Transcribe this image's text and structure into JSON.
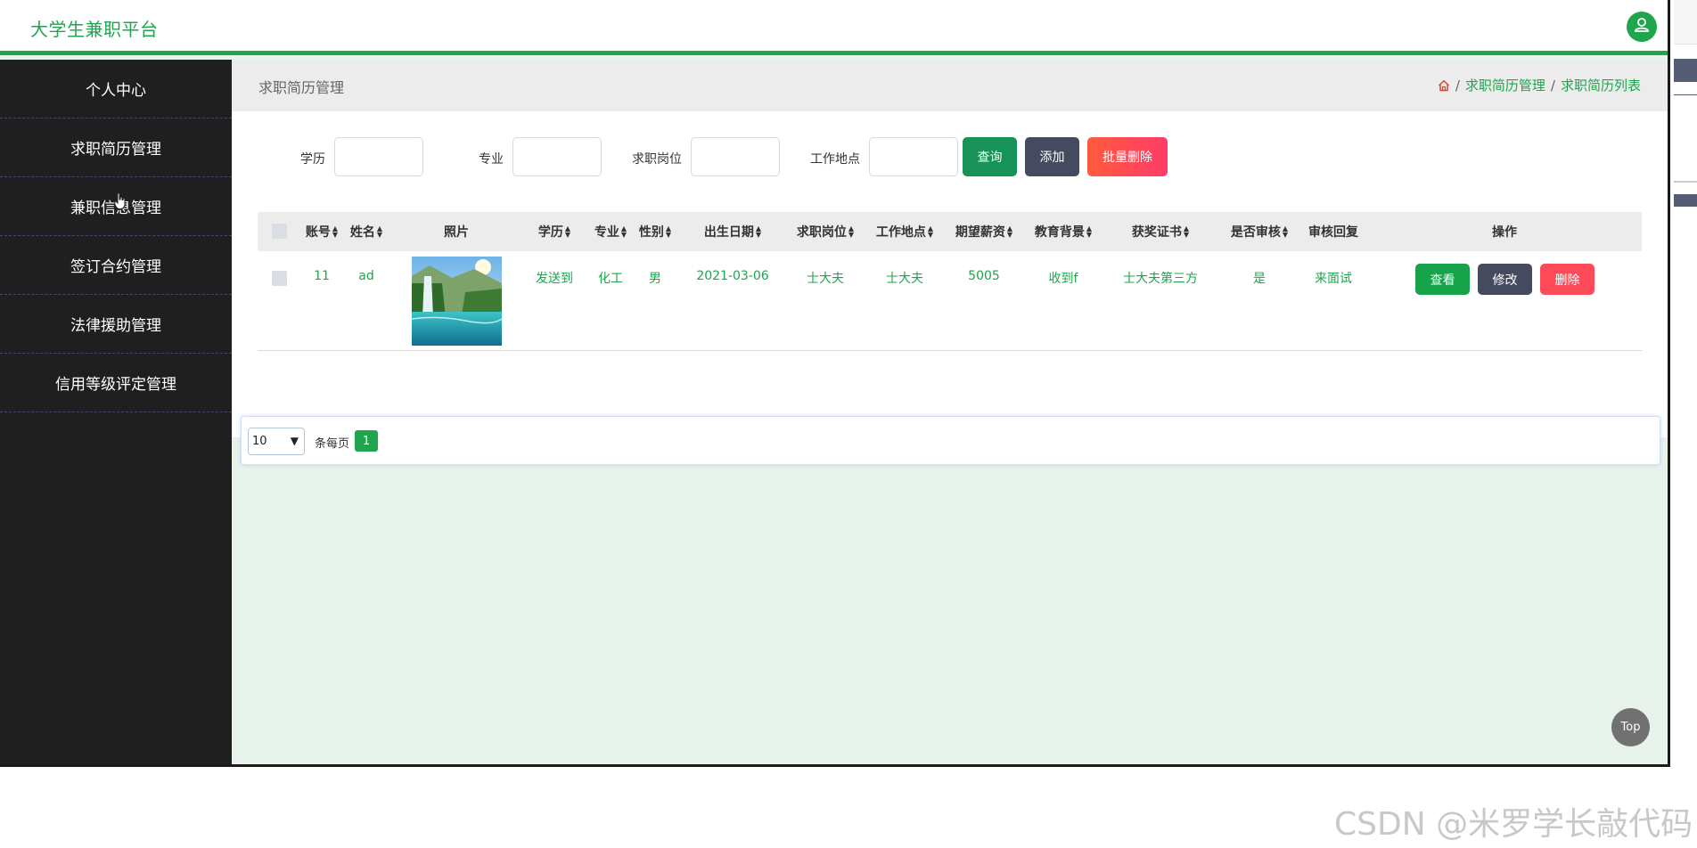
{
  "app": {
    "title": "大学生兼职平台"
  },
  "sidebar": {
    "items": [
      {
        "label": "个人中心"
      },
      {
        "label": "求职简历管理"
      },
      {
        "label": "兼职信息管理"
      },
      {
        "label": "签订合约管理"
      },
      {
        "label": "法律援助管理"
      },
      {
        "label": "信用等级评定管理"
      }
    ]
  },
  "breadcrumb": {
    "page_title": "求职简历管理",
    "items": [
      "求职简历管理",
      "求职简历列表"
    ],
    "separator": "/"
  },
  "search": {
    "fields": [
      {
        "label": "学历",
        "value": ""
      },
      {
        "label": "专业",
        "value": ""
      },
      {
        "label": "求职岗位",
        "value": ""
      },
      {
        "label": "工作地点",
        "value": ""
      }
    ],
    "search_label": "查询",
    "add_label": "添加",
    "batch_delete_label": "批量删除"
  },
  "table": {
    "columns": [
      "账号",
      "姓名",
      "照片",
      "学历",
      "专业",
      "性别",
      "出生日期",
      "求职岗位",
      "工作地点",
      "期望薪资",
      "教育背景",
      "获奖证书",
      "是否审核",
      "审核回复",
      "操作"
    ],
    "rows": [
      {
        "account": "11",
        "name": "ad",
        "education": "发送到",
        "major": "化工",
        "gender": "男",
        "birth_date": "2021-03-06",
        "job": "士大夫",
        "location": "士大夫",
        "salary": "5005",
        "edu_background": "收到f",
        "awards": "士大夫第三方",
        "reviewed": "是",
        "reply": "来面试",
        "view_label": "查看",
        "edit_label": "修改",
        "delete_label": "删除"
      }
    ]
  },
  "pagination": {
    "page_size": "10",
    "per_page_label": "条每页",
    "current_page": "1"
  },
  "top_button": "Top",
  "watermark": "CSDN @米罗学长敲代码",
  "colors": {
    "accent": "#1ea54e",
    "sidebar_bg": "#1f1f1f",
    "search_btn": "#17935a",
    "add_btn": "#454a5e",
    "delete_btn": "#ff4a5a",
    "content_bg": "#e6f2ea"
  },
  "icons": [
    "user-icon",
    "home-icon",
    "sort-icon",
    "chevron-down-icon"
  ]
}
